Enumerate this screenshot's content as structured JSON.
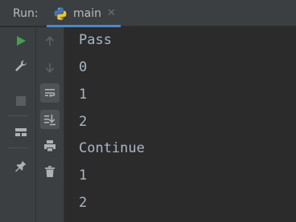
{
  "header": {
    "run_label": "Run:",
    "tab": {
      "label": "main",
      "icon": "python-icon",
      "close_glyph": "✕"
    }
  },
  "toolbar": {
    "column_1": [
      {
        "icon": "run-icon",
        "color": "#499c54"
      },
      {
        "icon": "wrench-icon"
      },
      {
        "icon": "stop-icon"
      },
      {
        "icon": "layout-icon"
      },
      {
        "icon": "pin-icon"
      }
    ],
    "column_2": [
      {
        "icon": "up-arrow-icon"
      },
      {
        "icon": "down-arrow-icon"
      },
      {
        "icon": "soft-wrap-icon"
      },
      {
        "icon": "scroll-to-end-icon"
      },
      {
        "icon": "print-icon"
      },
      {
        "icon": "trash-icon"
      }
    ]
  },
  "console": {
    "lines": [
      "Pass",
      "0",
      "1",
      "2",
      "Continue",
      "1",
      "2"
    ]
  },
  "colors": {
    "background": "#2b2b2b",
    "panel": "#3c3f41",
    "text": "#a9b7c6",
    "accent": "#4a88c7",
    "run_green": "#499c54"
  }
}
